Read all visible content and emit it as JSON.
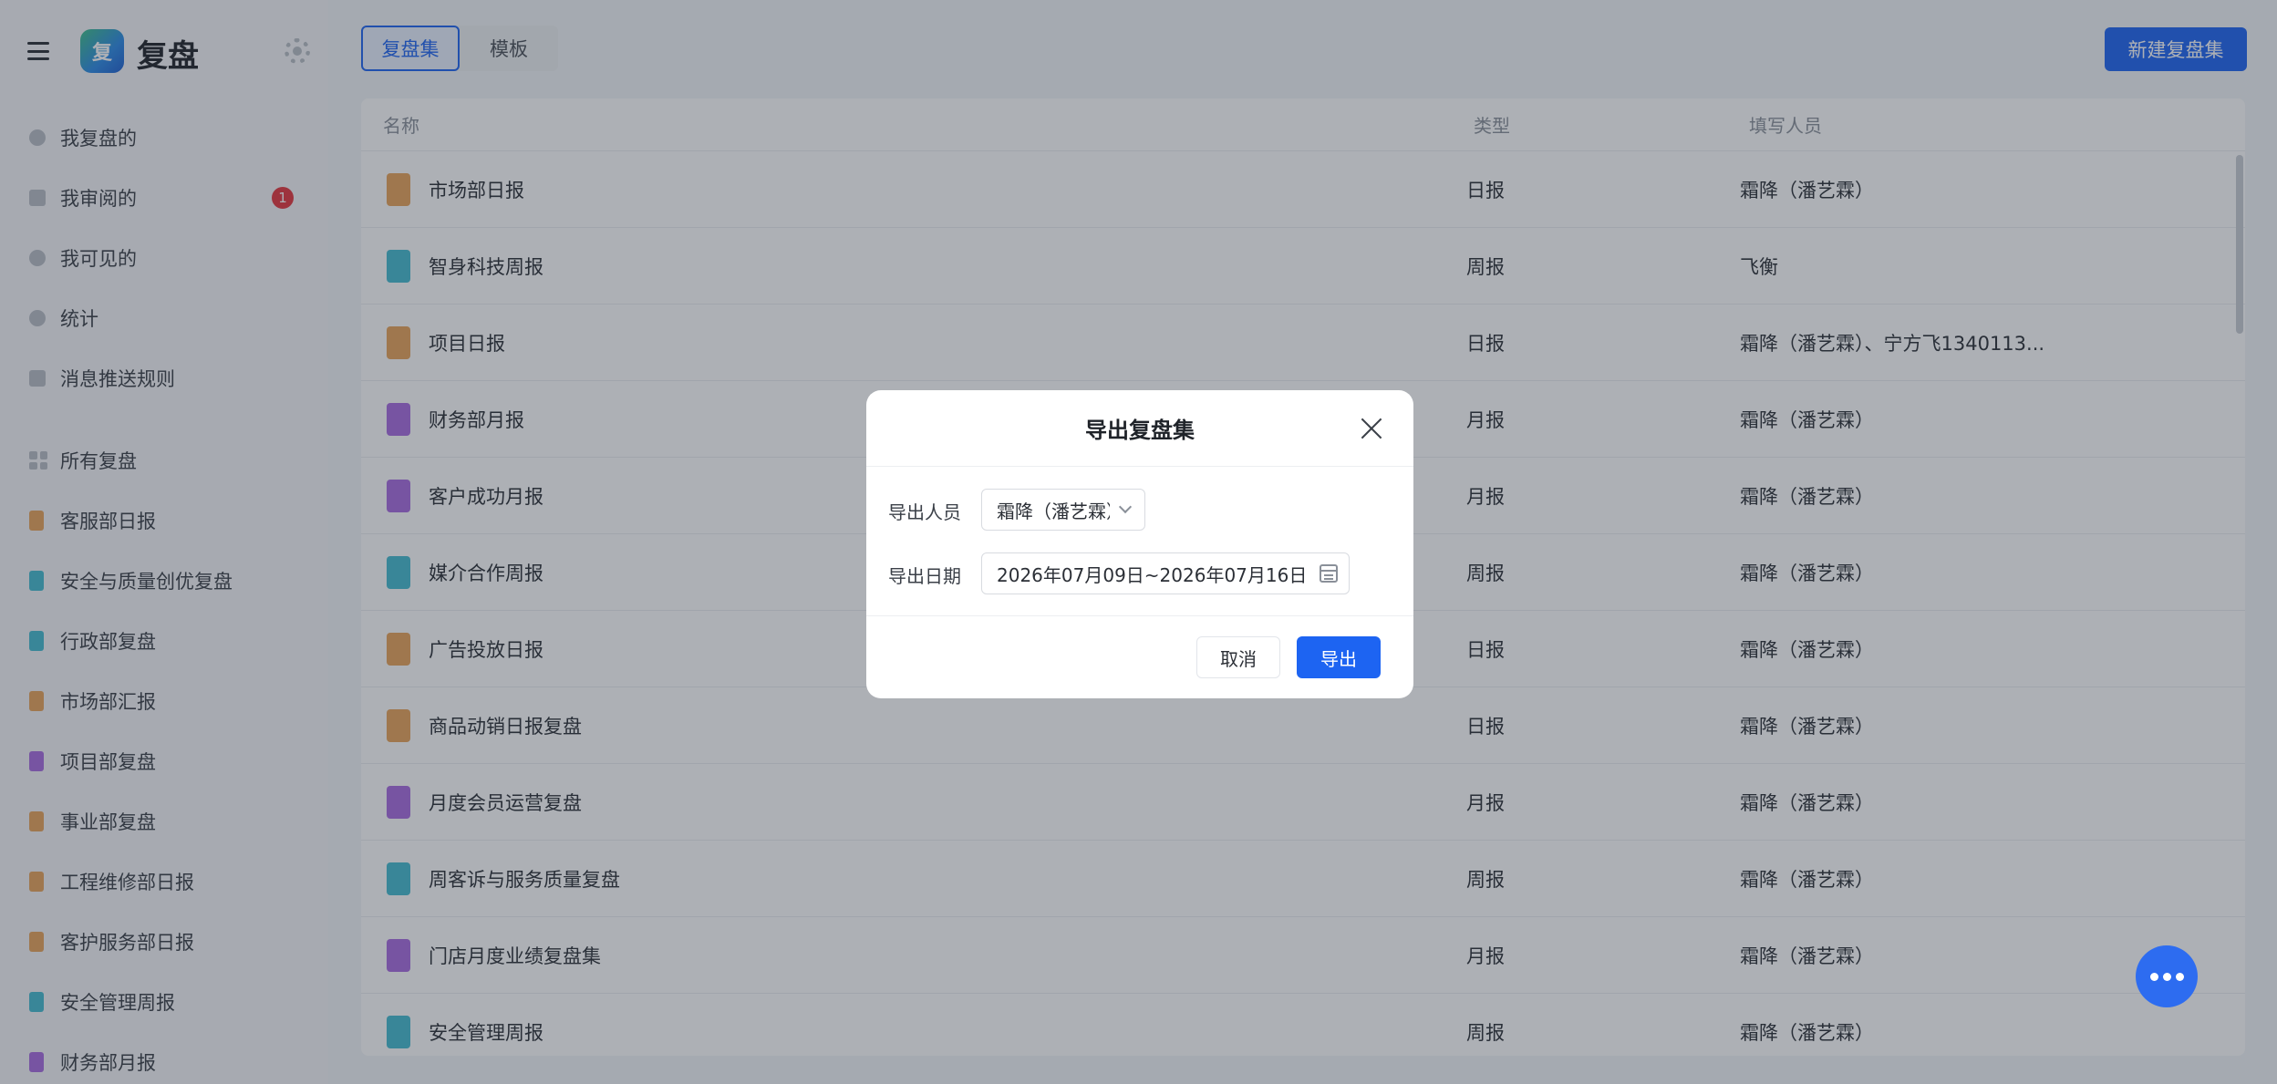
{
  "app": {
    "title": "复盘",
    "logo_letter": "复"
  },
  "sidebar": {
    "primary": [
      {
        "label": "我复盘的",
        "icon": "user-icon"
      },
      {
        "label": "我审阅的",
        "icon": "review-icon",
        "badge": "1"
      },
      {
        "label": "我可见的",
        "icon": "eye-icon"
      },
      {
        "label": "统计",
        "icon": "pie-chart-icon"
      },
      {
        "label": "消息推送规则",
        "icon": "edit-icon"
      }
    ],
    "all_label": "所有复盘",
    "groups": [
      {
        "label": "客服部日报",
        "color": "orange"
      },
      {
        "label": "安全与质量创优复盘",
        "color": "cyan"
      },
      {
        "label": "行政部复盘",
        "color": "cyan"
      },
      {
        "label": "市场部汇报",
        "color": "orange"
      },
      {
        "label": "项目部复盘",
        "color": "purple"
      },
      {
        "label": "事业部复盘",
        "color": "orange"
      },
      {
        "label": "工程维修部日报",
        "color": "orange"
      },
      {
        "label": "客护服务部日报",
        "color": "orange"
      },
      {
        "label": "安全管理周报",
        "color": "cyan"
      },
      {
        "label": "财务部月报",
        "color": "purple"
      }
    ]
  },
  "tabs": [
    {
      "label": "复盘集",
      "active": true
    },
    {
      "label": "模板",
      "active": false
    }
  ],
  "new_button": "新建复盘集",
  "table": {
    "headers": {
      "name": "名称",
      "type": "类型",
      "owner": "填写人员"
    },
    "rows": [
      {
        "name": "市场部日报",
        "type": "日报",
        "owner": "霜降（潘艺霖）",
        "color": "orange"
      },
      {
        "name": "智身科技周报",
        "type": "周报",
        "owner": "飞衡",
        "color": "cyan"
      },
      {
        "name": "项目日报",
        "type": "日报",
        "owner": "霜降（潘艺霖）、宁方飞1340113...",
        "color": "orange"
      },
      {
        "name": "财务部月报",
        "type": "月报",
        "owner": "霜降（潘艺霖）",
        "color": "purple"
      },
      {
        "name": "客户成功月报",
        "type": "月报",
        "owner": "霜降（潘艺霖）",
        "color": "purple"
      },
      {
        "name": "媒介合作周报",
        "type": "周报",
        "owner": "霜降（潘艺霖）",
        "color": "cyan"
      },
      {
        "name": "广告投放日报",
        "type": "日报",
        "owner": "霜降（潘艺霖）",
        "color": "orange"
      },
      {
        "name": "商品动销日报复盘",
        "type": "日报",
        "owner": "霜降（潘艺霖）",
        "color": "orange"
      },
      {
        "name": "月度会员运营复盘",
        "type": "月报",
        "owner": "霜降（潘艺霖）",
        "color": "purple"
      },
      {
        "name": "周客诉与服务质量复盘",
        "type": "周报",
        "owner": "霜降（潘艺霖）",
        "color": "cyan"
      },
      {
        "name": "门店月度业绩复盘集",
        "type": "月报",
        "owner": "霜降（潘艺霖）",
        "color": "purple"
      },
      {
        "name": "安全管理周报",
        "type": "周报",
        "owner": "霜降（潘艺霖）",
        "color": "cyan"
      }
    ]
  },
  "modal": {
    "title": "导出复盘集",
    "person_label": "导出人员",
    "person_value": "霜降（潘艺霖）",
    "date_label": "导出日期",
    "date_value": "2026年07月09日~2026年07月16日",
    "cancel_label": "取消",
    "export_label": "导出"
  },
  "colors": {
    "primary": "#1d64f2",
    "badge": "#e5363e",
    "orange": "#e8a35a",
    "cyan": "#45bcd1",
    "purple": "#a86be0"
  }
}
